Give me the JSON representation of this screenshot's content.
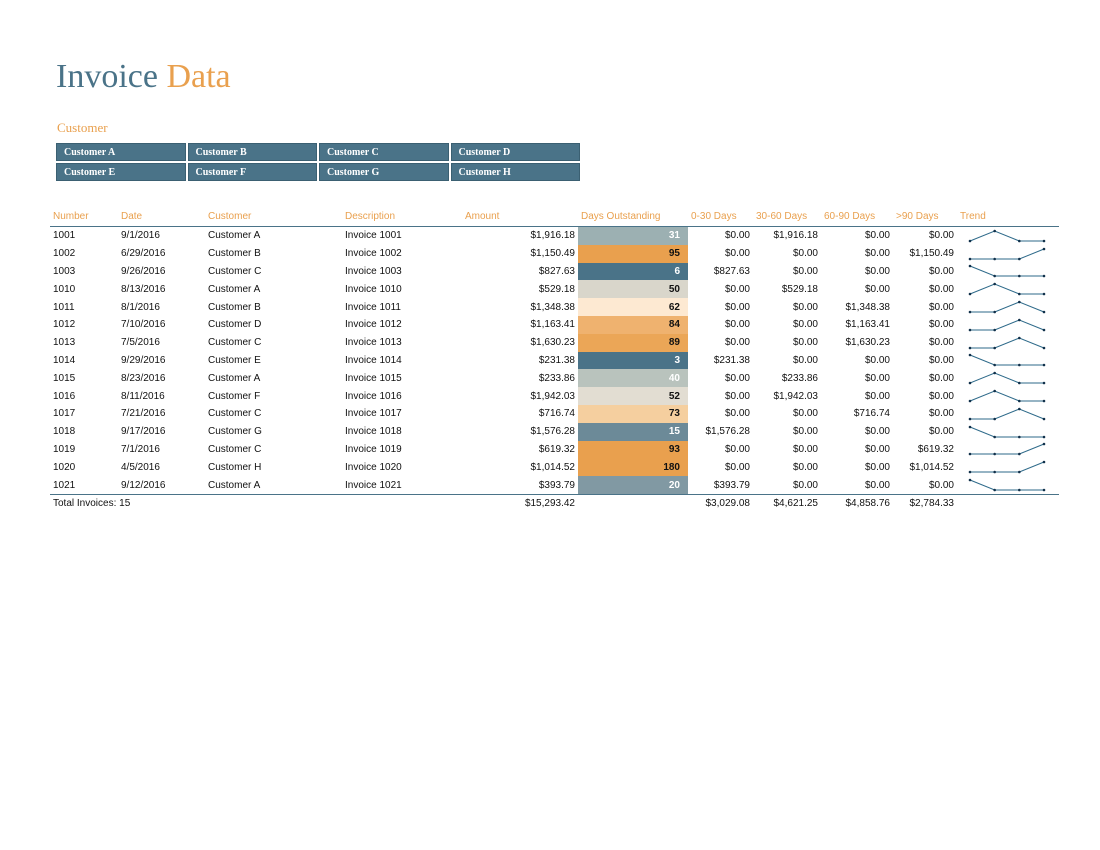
{
  "title": {
    "part1": "Invoice",
    "part2": "Data"
  },
  "slicer": {
    "label": "Customer",
    "items": [
      "Customer A",
      "Customer B",
      "Customer C",
      "Customer D",
      "Customer E",
      "Customer F",
      "Customer G",
      "Customer H"
    ]
  },
  "table": {
    "headers": [
      "Number",
      "Date",
      "Customer",
      "Description",
      "Amount",
      "Days Outstanding",
      "0-30 Days",
      "30-60 Days",
      "60-90 Days",
      ">90 Days",
      "Trend"
    ],
    "rows": [
      {
        "number": "1001",
        "date": "9/1/2016",
        "customer": "Customer A",
        "description": "Invoice 1001",
        "amount": "$1,916.18",
        "days": "31",
        "d0_30": "$0.00",
        "d30_60": "$1,916.18",
        "d60_90": "$0.00",
        "d90": "$0.00",
        "days_bg": "#9cb0b2",
        "days_fg": "#ffffff",
        "trend": [
          0,
          1,
          0,
          0
        ]
      },
      {
        "number": "1002",
        "date": "6/29/2016",
        "customer": "Customer B",
        "description": "Invoice 1002",
        "amount": "$1,150.49",
        "days": "95",
        "d0_30": "$0.00",
        "d30_60": "$0.00",
        "d60_90": "$0.00",
        "d90": "$1,150.49",
        "days_bg": "#e9a04e",
        "days_fg": "#111111",
        "trend": [
          0,
          0,
          0,
          1
        ]
      },
      {
        "number": "1003",
        "date": "9/26/2016",
        "customer": "Customer C",
        "description": "Invoice 1003",
        "amount": "$827.63",
        "days": "6",
        "d0_30": "$827.63",
        "d30_60": "$0.00",
        "d60_90": "$0.00",
        "d90": "$0.00",
        "days_bg": "#4a7388",
        "days_fg": "#ffffff",
        "trend": [
          1,
          0,
          0,
          0
        ]
      },
      {
        "number": "1010",
        "date": "8/13/2016",
        "customer": "Customer A",
        "description": "Invoice 1010",
        "amount": "$529.18",
        "days": "50",
        "d0_30": "$0.00",
        "d30_60": "$529.18",
        "d60_90": "$0.00",
        "d90": "$0.00",
        "days_bg": "#d9d6cb",
        "days_fg": "#111111",
        "trend": [
          0,
          1,
          0,
          0
        ]
      },
      {
        "number": "1011",
        "date": "8/1/2016",
        "customer": "Customer B",
        "description": "Invoice 1011",
        "amount": "$1,348.38",
        "days": "62",
        "d0_30": "$0.00",
        "d30_60": "$0.00",
        "d60_90": "$1,348.38",
        "d90": "$0.00",
        "days_bg": "#fde9d2",
        "days_fg": "#111111",
        "trend": [
          0,
          0,
          1,
          0
        ]
      },
      {
        "number": "1012",
        "date": "7/10/2016",
        "customer": "Customer D",
        "description": "Invoice 1012",
        "amount": "$1,163.41",
        "days": "84",
        "d0_30": "$0.00",
        "d30_60": "$0.00",
        "d60_90": "$1,163.41",
        "d90": "$0.00",
        "days_bg": "#efb26f",
        "days_fg": "#111111",
        "trend": [
          0,
          0,
          1,
          0
        ]
      },
      {
        "number": "1013",
        "date": "7/5/2016",
        "customer": "Customer C",
        "description": "Invoice 1013",
        "amount": "$1,630.23",
        "days": "89",
        "d0_30": "$0.00",
        "d30_60": "$0.00",
        "d60_90": "$1,630.23",
        "d90": "$0.00",
        "days_bg": "#eba657",
        "days_fg": "#111111",
        "trend": [
          0,
          0,
          1,
          0
        ]
      },
      {
        "number": "1014",
        "date": "9/29/2016",
        "customer": "Customer E",
        "description": "Invoice 1014",
        "amount": "$231.38",
        "days": "3",
        "d0_30": "$231.38",
        "d30_60": "$0.00",
        "d60_90": "$0.00",
        "d90": "$0.00",
        "days_bg": "#4a7388",
        "days_fg": "#ffffff",
        "trend": [
          1,
          0,
          0,
          0
        ]
      },
      {
        "number": "1015",
        "date": "8/23/2016",
        "customer": "Customer A",
        "description": "Invoice 1015",
        "amount": "$233.86",
        "days": "40",
        "d0_30": "$0.00",
        "d30_60": "$233.86",
        "d60_90": "$0.00",
        "d90": "$0.00",
        "days_bg": "#b9c3bd",
        "days_fg": "#ffffff",
        "trend": [
          0,
          1,
          0,
          0
        ]
      },
      {
        "number": "1016",
        "date": "8/11/2016",
        "customer": "Customer F",
        "description": "Invoice 1016",
        "amount": "$1,942.03",
        "days": "52",
        "d0_30": "$0.00",
        "d30_60": "$1,942.03",
        "d60_90": "$0.00",
        "d90": "$0.00",
        "days_bg": "#e2ddd2",
        "days_fg": "#111111",
        "trend": [
          0,
          1,
          0,
          0
        ]
      },
      {
        "number": "1017",
        "date": "7/21/2016",
        "customer": "Customer C",
        "description": "Invoice 1017",
        "amount": "$716.74",
        "days": "73",
        "d0_30": "$0.00",
        "d30_60": "$0.00",
        "d60_90": "$716.74",
        "d90": "$0.00",
        "days_bg": "#f5cf9f",
        "days_fg": "#111111",
        "trend": [
          0,
          0,
          1,
          0
        ]
      },
      {
        "number": "1018",
        "date": "9/17/2016",
        "customer": "Customer G",
        "description": "Invoice 1018",
        "amount": "$1,576.28",
        "days": "15",
        "d0_30": "$1,576.28",
        "d30_60": "$0.00",
        "d60_90": "$0.00",
        "d90": "$0.00",
        "days_bg": "#6c8a98",
        "days_fg": "#ffffff",
        "trend": [
          1,
          0,
          0,
          0
        ]
      },
      {
        "number": "1019",
        "date": "7/1/2016",
        "customer": "Customer C",
        "description": "Invoice 1019",
        "amount": "$619.32",
        "days": "93",
        "d0_30": "$0.00",
        "d30_60": "$0.00",
        "d60_90": "$0.00",
        "d90": "$619.32",
        "days_bg": "#e9a04e",
        "days_fg": "#111111",
        "trend": [
          0,
          0,
          0,
          1
        ]
      },
      {
        "number": "1020",
        "date": "4/5/2016",
        "customer": "Customer H",
        "description": "Invoice 1020",
        "amount": "$1,014.52",
        "days": "180",
        "d0_30": "$0.00",
        "d30_60": "$0.00",
        "d60_90": "$0.00",
        "d90": "$1,014.52",
        "days_bg": "#e9a04e",
        "days_fg": "#111111",
        "trend": [
          0,
          0,
          0,
          1
        ]
      },
      {
        "number": "1021",
        "date": "9/12/2016",
        "customer": "Customer A",
        "description": "Invoice 1021",
        "amount": "$393.79",
        "days": "20",
        "d0_30": "$393.79",
        "d30_60": "$0.00",
        "d60_90": "$0.00",
        "d90": "$0.00",
        "days_bg": "#8199a3",
        "days_fg": "#ffffff",
        "trend": [
          1,
          0,
          0,
          0
        ]
      }
    ],
    "totals": {
      "label": "Total Invoices: 15",
      "amount": "$15,293.42",
      "d0_30": "$3,029.08",
      "d30_60": "$4,621.25",
      "d60_90": "$4,858.76",
      "d90": "$2,784.33"
    }
  },
  "colors": {
    "primary": "#4a7388",
    "accent": "#e9a04e",
    "spark": "#2e6a8a"
  }
}
